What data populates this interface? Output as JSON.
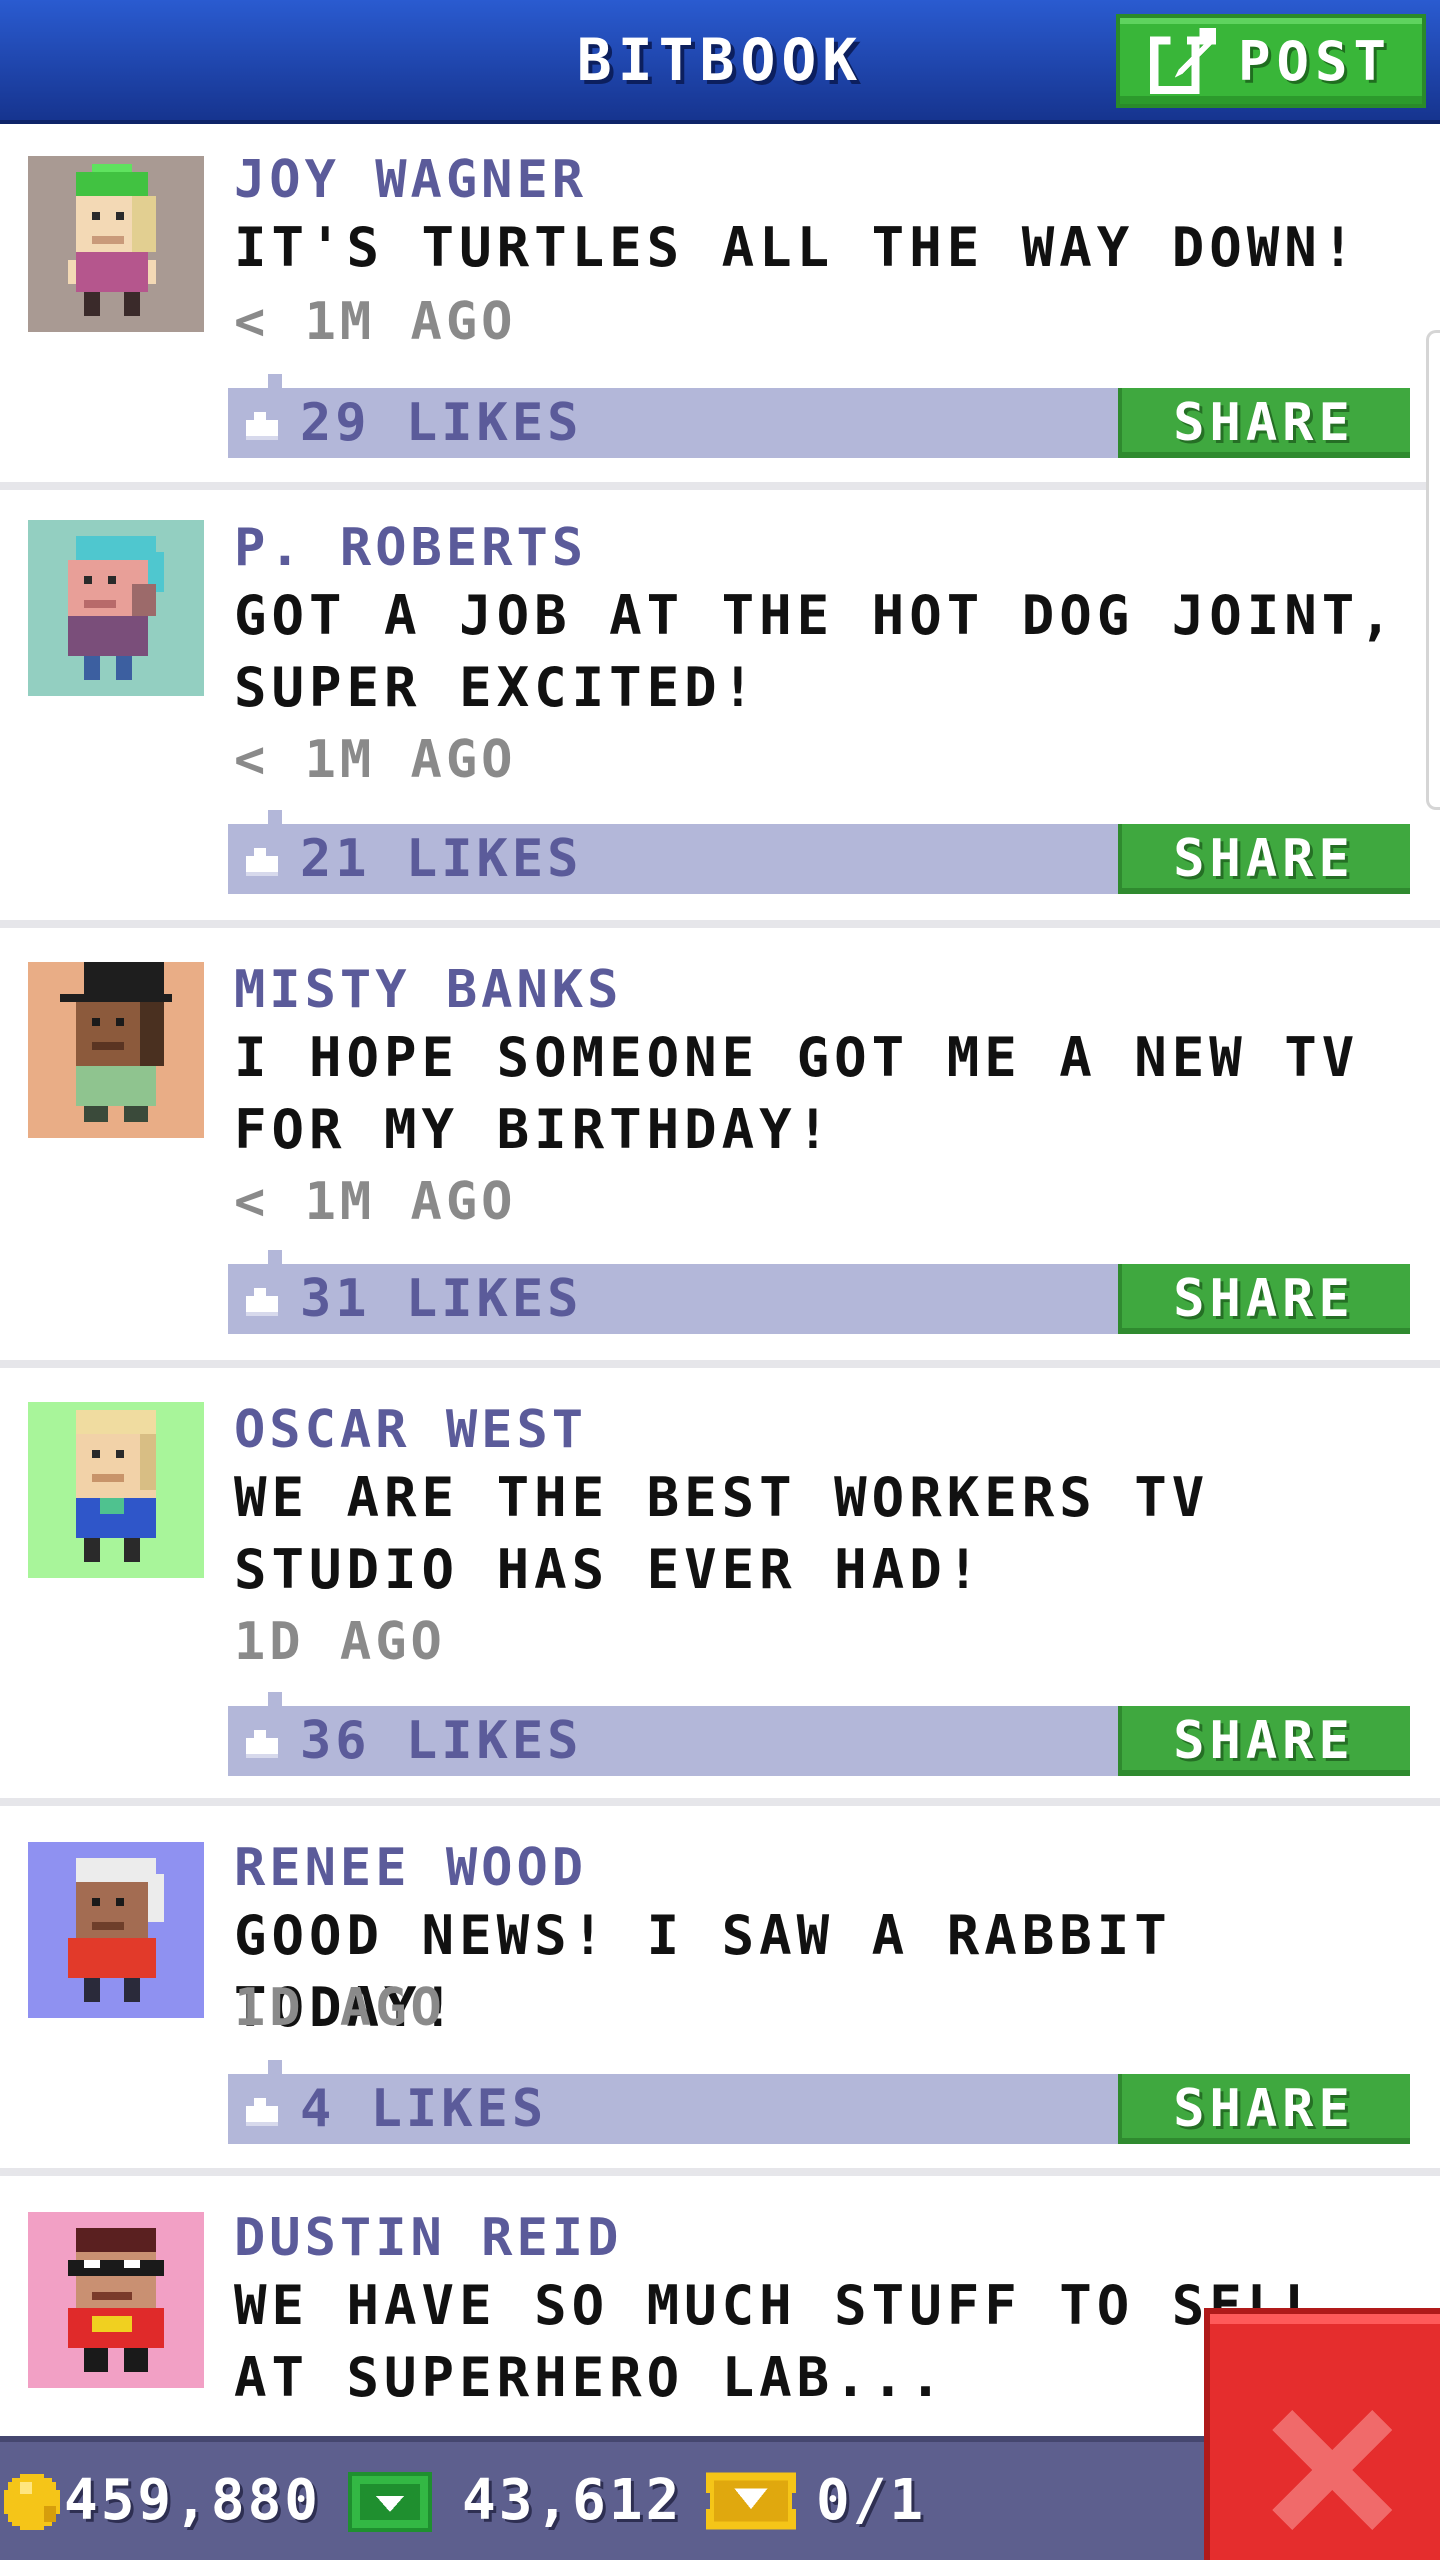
{
  "header": {
    "title": "BITBOOK",
    "post_label": "POST"
  },
  "posts": [
    {
      "name": "JOY WAGNER",
      "text": "IT'S TURTLES ALL THE WAY DOWN!",
      "time": "< 1M AGO",
      "likes": "29 LIKES",
      "share_label": "SHARE",
      "avatar_bg": "#a99a93",
      "avatar_icon": "avatar-green-cap"
    },
    {
      "name": "P. ROBERTS",
      "text": "GOT A JOB AT THE HOT DOG JOINT, SUPER EXCITED!",
      "time": "< 1M AGO",
      "likes": "21 LIKES",
      "share_label": "SHARE",
      "avatar_bg": "#93cfc1",
      "avatar_icon": "avatar-teal-hair"
    },
    {
      "name": "MISTY BANKS",
      "text": "I HOPE SOMEONE GOT ME A NEW TV FOR MY BIRTHDAY!",
      "time": "< 1M AGO",
      "likes": "31 LIKES",
      "share_label": "SHARE",
      "avatar_bg": "#e9ad86",
      "avatar_icon": "avatar-top-hat"
    },
    {
      "name": "OSCAR WEST",
      "text": "WE ARE THE BEST WORKERS TV STUDIO HAS EVER HAD!",
      "time": "1D AGO",
      "likes": "36 LIKES",
      "share_label": "SHARE",
      "avatar_bg": "#a8f59a",
      "avatar_icon": "avatar-blonde"
    },
    {
      "name": "RENEE WOOD",
      "text": "GOOD NEWS! I SAW A RABBIT TODAY!",
      "time": "1D AGO",
      "likes": "4 LIKES",
      "share_label": "SHARE",
      "avatar_bg": "#8f91f1",
      "avatar_icon": "avatar-white-hair"
    },
    {
      "name": "DUSTIN REID",
      "text": "WE HAVE SO MUCH STUFF TO SELL AT SUPERHERO LAB...",
      "time": "",
      "likes": "",
      "share_label": "",
      "avatar_bg": "#f2a0c5",
      "avatar_icon": "avatar-masked-hero"
    }
  ],
  "footer": {
    "coins": "459,880",
    "bux": "43,612",
    "tickets": "0/1"
  },
  "colors": {
    "header_blue": "#1f47b8",
    "post_green": "#39b639",
    "share_green": "#3fa83f",
    "likes_bar": "#b3b7d9",
    "name_purple": "#5b5b9a",
    "bottom_bar": "#5d5f8e",
    "close_red": "#e52d2d"
  }
}
